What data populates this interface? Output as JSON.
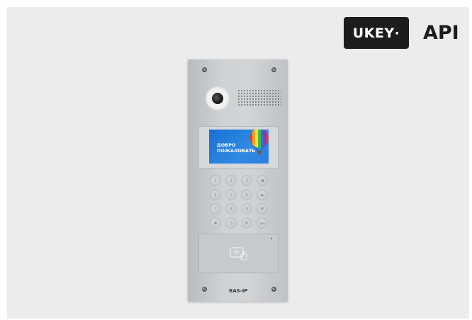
{
  "branding": {
    "badge_label": "UKEY·",
    "api_label": "API"
  },
  "device": {
    "display_text": "ДОБРО\nПОЖАЛОВАТЬ",
    "brand_label": "BAS-IP",
    "keypad": {
      "keys": [
        "1",
        "2",
        "3",
        "4",
        "5",
        "6",
        "7",
        "8",
        "9",
        "0",
        "",
        ""
      ]
    }
  },
  "colors": {
    "badge_bg": "#1c1c1c",
    "screen_bg": "#1a6fd1"
  }
}
